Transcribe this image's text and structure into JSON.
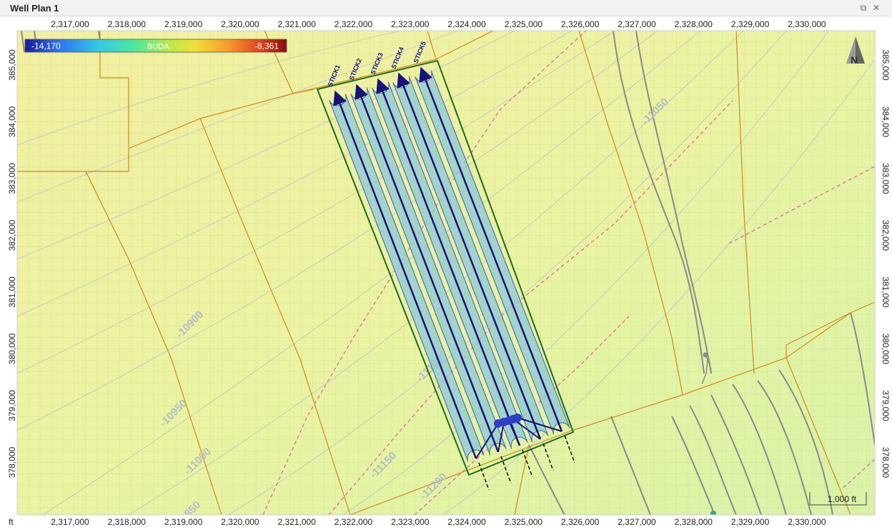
{
  "window": {
    "title": "Well Plan 1",
    "restore_icon": "restore-icon",
    "close_icon": "close-icon"
  },
  "axes": {
    "x_ticks": [
      "2,317,000",
      "2,318,000",
      "2,319,000",
      "2,320,000",
      "2,321,000",
      "2,322,000",
      "2,323,000",
      "2,324,000",
      "2,325,000",
      "2,326,000",
      "2,327,000",
      "2,328,000",
      "2,329,000",
      "2,330,000"
    ],
    "y_ticks": [
      "385,000",
      "384,000",
      "383,000",
      "382,000",
      "381,000",
      "380,000",
      "379,000",
      "378,000"
    ],
    "unit_label": "ft"
  },
  "color_scale": {
    "min_label": "-14,170",
    "surface_name": "BUDA",
    "max_label": "-8,361",
    "colors": [
      "#1a1a9e",
      "#2d6ff0",
      "#33c8e8",
      "#4de89a",
      "#b7e94a",
      "#f2e03a",
      "#f59a2a",
      "#e0401c",
      "#8b0e0e"
    ]
  },
  "contours": {
    "labels": [
      "-10900",
      "-10950",
      "-11000",
      "-11050",
      "-11100",
      "-11150",
      "-11200",
      "-10850"
    ]
  },
  "wells": {
    "names": [
      "STICK1",
      "STICK2",
      "STICK3",
      "STICK4",
      "STICK5"
    ]
  },
  "scale_bar": {
    "label": "1,000 ft"
  },
  "north_arrow": {
    "label": "N",
    "icon": "north-arrow-icon"
  },
  "colors": {
    "background_map": "#e9f4a0",
    "lease_line": "#d08a1e",
    "fault_dashed": "#e06aa0",
    "unit_boundary": "#1e6b1e",
    "lateral": "#14147a",
    "buffer_fill": "#8cc8d8",
    "grey_contour": "#8a8a8a"
  }
}
